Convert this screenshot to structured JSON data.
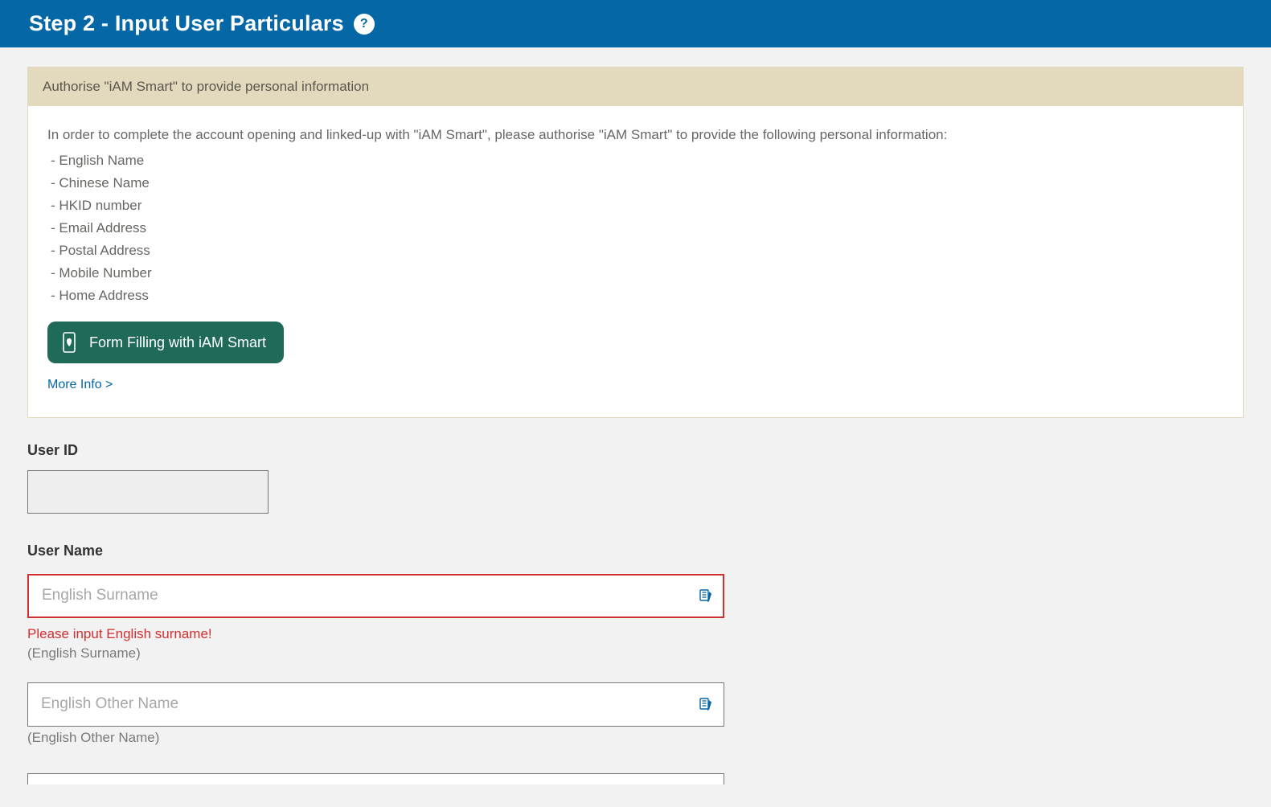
{
  "header": {
    "title": "Step 2 - Input User Particulars"
  },
  "authorise": {
    "header": "Authorise \"iAM Smart\" to provide personal information",
    "intro": "In order to complete the account opening and linked-up with \"iAM Smart\", please authorise \"iAM Smart\" to provide the following personal information:",
    "items": [
      "- English Name",
      "- Chinese Name",
      "- HKID number",
      "- Email Address",
      "- Postal Address",
      "- Mobile Number",
      "- Home Address"
    ],
    "button_label": "Form Filling with iAM Smart",
    "more_info": "More Info >"
  },
  "form": {
    "user_id_label": "User ID",
    "user_id_value": "",
    "user_name_label": "User Name",
    "english_surname": {
      "placeholder": "English Surname",
      "value": "",
      "error": "Please input English surname!",
      "hint": "(English Surname)"
    },
    "english_other_name": {
      "placeholder": "English Other Name",
      "value": "",
      "hint": "(English Other Name)"
    }
  }
}
